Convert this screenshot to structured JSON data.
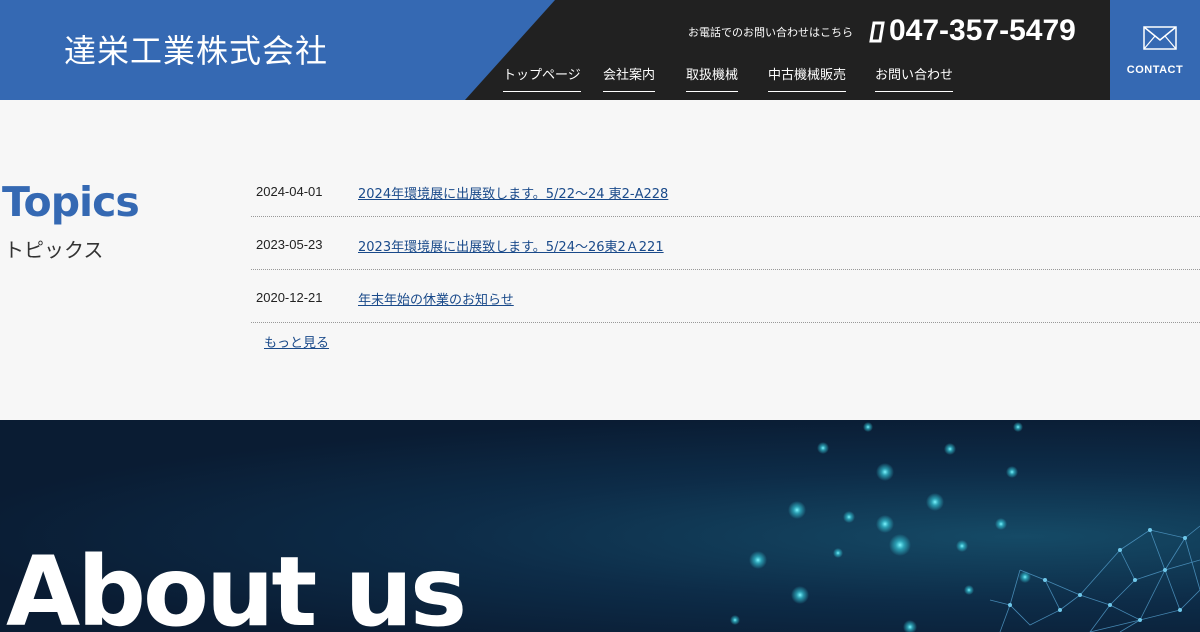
{
  "header": {
    "company_name": "達栄工業株式会社",
    "tel_note": "お電話でのお問い合わせはこちら",
    "tel_number": "047-357-5479",
    "nav": [
      {
        "label": "トップページ"
      },
      {
        "label": "会社案内"
      },
      {
        "label": "取扱機械"
      },
      {
        "label": "中古機械販売"
      },
      {
        "label": "お問い合わせ"
      }
    ],
    "contact_label": "CONTACT",
    "contact_icon": "envelope-icon",
    "tel_icon": "phone-icon",
    "colors": {
      "brand_blue": "#3569b3",
      "dark": "#212121"
    }
  },
  "topics": {
    "heading_en": "Topics",
    "heading_jp": "トピックス",
    "items": [
      {
        "date": "2024-04-01",
        "title": "2024年環境展に出展致します。5/22～24 東2-A228"
      },
      {
        "date": "2023-05-23",
        "title": "2023年環境展に出展致します。5/24～26東2Ａ221"
      },
      {
        "date": "2020-12-21",
        "title": "年末年始の休業のお知らせ"
      }
    ],
    "more_label": "もっと見る"
  },
  "about": {
    "heading": "About us"
  }
}
